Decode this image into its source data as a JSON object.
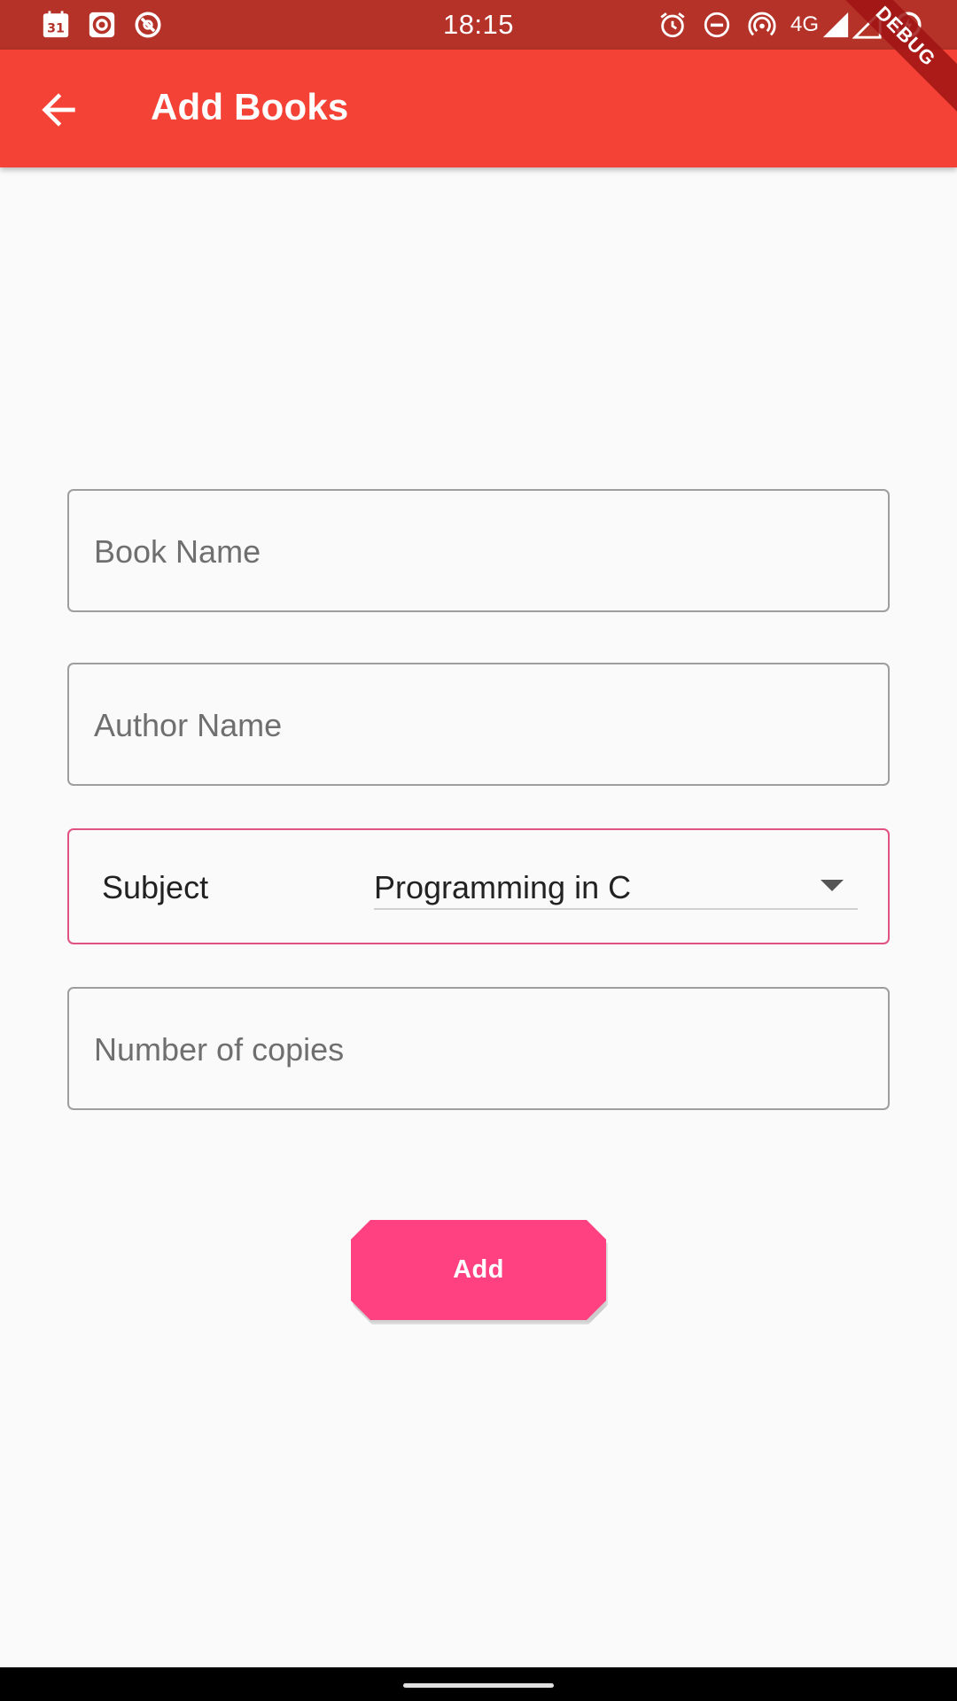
{
  "status_bar": {
    "time": "18:15",
    "calendar_day": "31",
    "network": "4G",
    "left_icons": [
      "calendar-icon",
      "record-icon",
      "vpn-icon"
    ],
    "right_icons": [
      "alarm-icon",
      "do-not-disturb-icon",
      "hotspot-icon",
      "signal-icon",
      "signal-icon",
      "battery-icon"
    ]
  },
  "app_bar": {
    "title": "Add Books",
    "back_icon": "arrow-back-icon",
    "color": "#f44336"
  },
  "debug_banner": "DEBUG",
  "form": {
    "book_name_placeholder": "Book Name",
    "author_name_placeholder": "Author Name",
    "subject_label": "Subject",
    "subject_value": "Programming in C",
    "copies_placeholder": "Number of copies"
  },
  "add_button": {
    "label": "Add",
    "color": "#ff4081"
  }
}
